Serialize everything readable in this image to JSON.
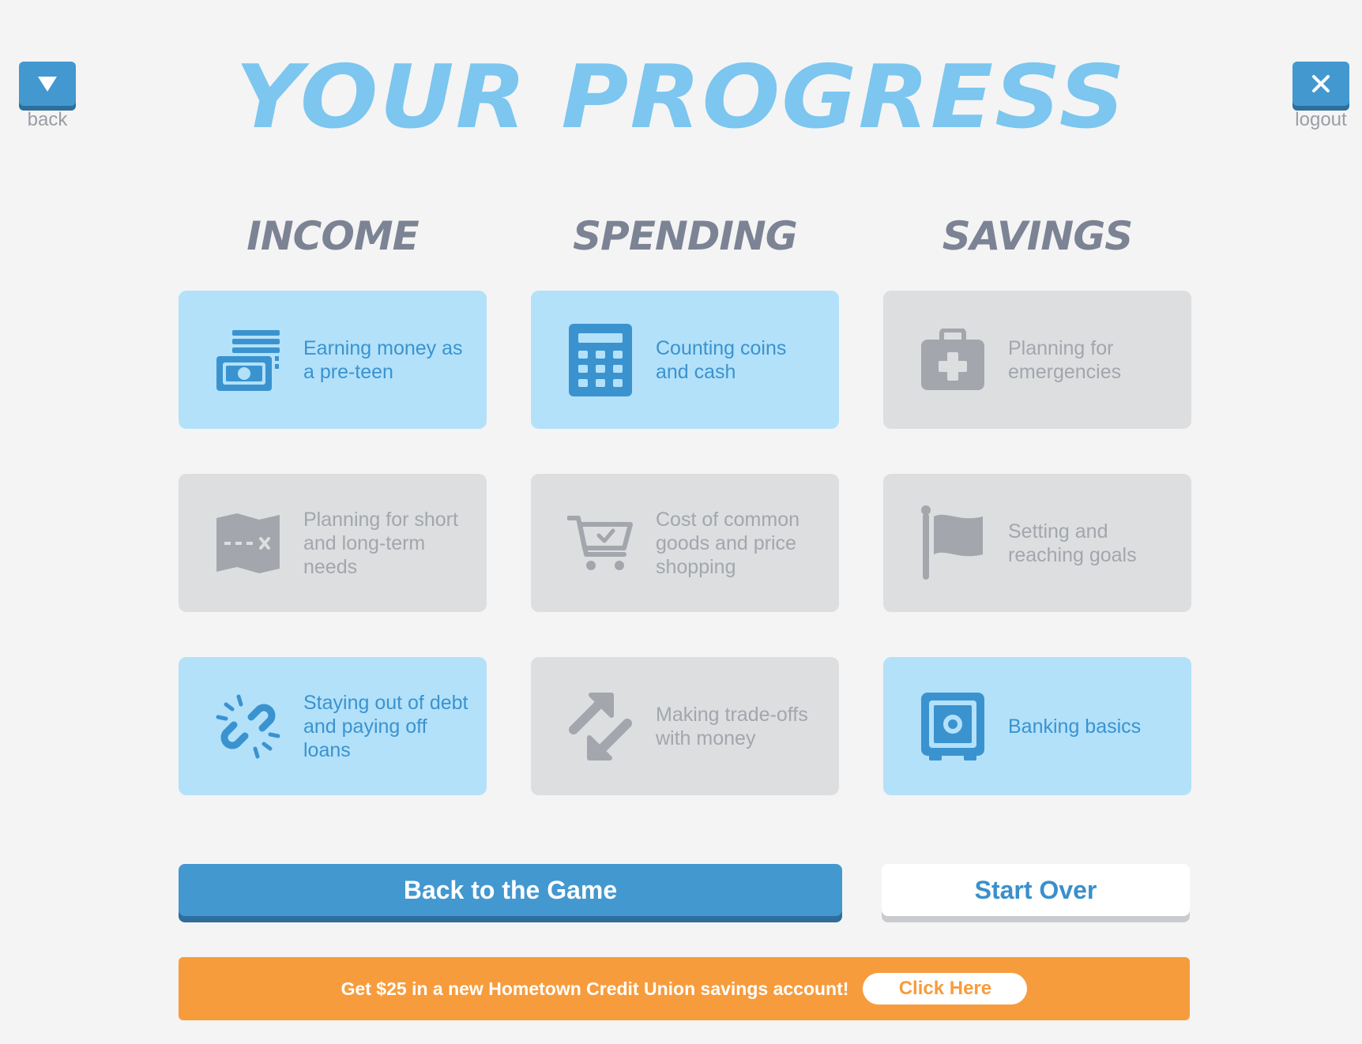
{
  "header": {
    "title": "YOUR PROGRESS",
    "back_label": "back",
    "logout_label": "logout"
  },
  "columns": [
    {
      "heading": "INCOME"
    },
    {
      "heading": "SPENDING"
    },
    {
      "heading": "SAVINGS"
    }
  ],
  "cards": [
    {
      "label": "Earning money as a pre-teen",
      "icon": "money-stack-icon",
      "status": "completed"
    },
    {
      "label": "Counting coins and cash",
      "icon": "calculator-icon",
      "status": "completed"
    },
    {
      "label": "Planning for emergencies",
      "icon": "first-aid-kit-icon",
      "status": "locked"
    },
    {
      "label": "Planning for short and long-term needs",
      "icon": "map-icon",
      "status": "locked"
    },
    {
      "label": "Cost of common goods and price shopping",
      "icon": "shopping-cart-icon",
      "status": "locked"
    },
    {
      "label": "Setting and reaching goals",
      "icon": "flag-icon",
      "status": "locked"
    },
    {
      "label": "Staying out of debt and paying off loans",
      "icon": "broken-link-icon",
      "status": "completed"
    },
    {
      "label": "Making trade-offs with money",
      "icon": "swap-arrows-icon",
      "status": "locked"
    },
    {
      "label": "Banking basics",
      "icon": "safe-icon",
      "status": "completed"
    }
  ],
  "actions": {
    "back_to_game": "Back to the Game",
    "start_over": "Start Over"
  },
  "promo": {
    "text": "Get $25 in a new Hometown Credit Union savings account!",
    "link_label": "Click Here"
  },
  "colors": {
    "accent_blue": "#4398d0",
    "title_blue": "#7cc6f0",
    "card_active": "#b3e1fa",
    "card_inactive": "#dcdee0",
    "promo_orange": "#f79c3c"
  }
}
